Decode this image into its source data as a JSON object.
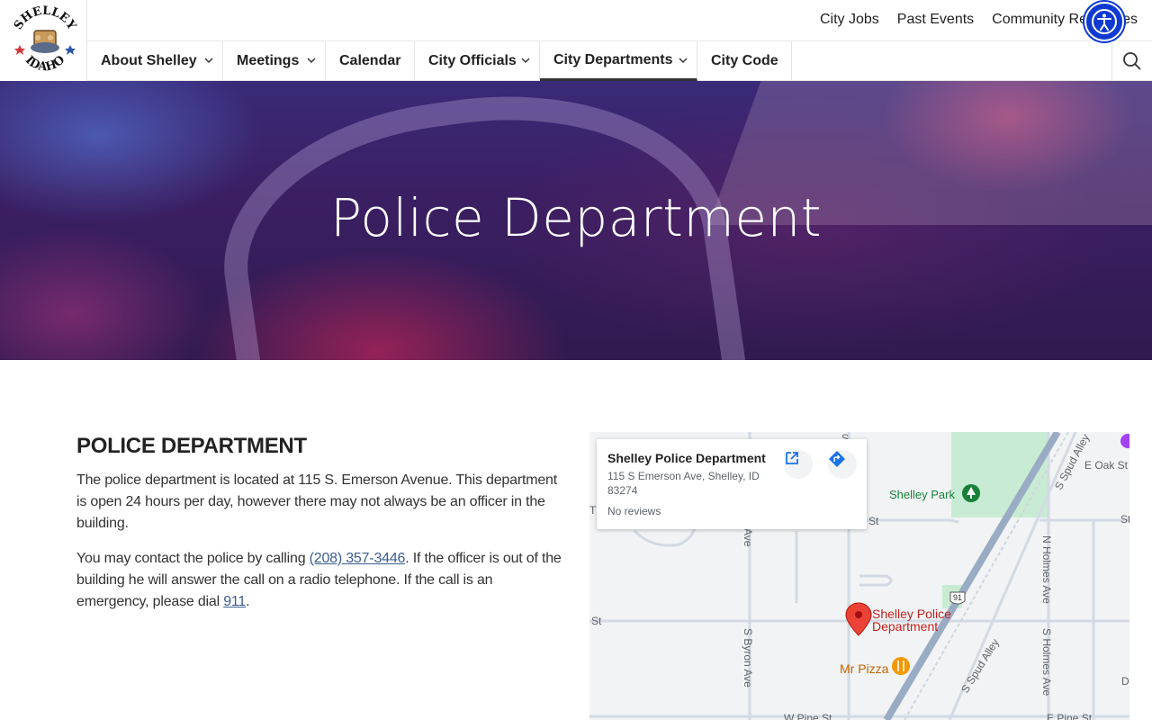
{
  "logo": {
    "top_text": "SHELLEY",
    "bottom_text": "IDAHO"
  },
  "top_links": [
    "City Jobs",
    "Past Events",
    "Community Resources"
  ],
  "nav": {
    "items": [
      {
        "label": "About Shelley"
      },
      {
        "label": "Meetings"
      },
      {
        "label": "Calendar"
      },
      {
        "label": "City Officials"
      },
      {
        "label": "City Departments"
      },
      {
        "label": "City Code"
      }
    ]
  },
  "hero": {
    "title": "Police Department"
  },
  "content": {
    "heading": "POLICE DEPARTMENT",
    "p1": "The police department is located at 115 S. Emerson Avenue. This department is open 24 hours per day, however there may not always be an officer in the building.",
    "p2_before": "You may contact the police by calling ",
    "phone": "(208) 357-3446",
    "p2_middle": ". If the officer is out of the building he will answer the call on a radio telephone. If the call is an emergency, please dial ",
    "emergency": "911",
    "p2_after": "."
  },
  "map": {
    "place_name": "Shelley Police Department",
    "address": "115 S Emerson Ave, Shelley, ID 83274",
    "reviews": "No reviews",
    "pin_label_line1": "Shelley Police",
    "pin_label_line2": "Department",
    "park": "Shelley Park",
    "restaurant": "Mr Pizza",
    "streets": {
      "e_oak": "E Oak St",
      "st_a": "St",
      "st_b": "St",
      "st_c": "St",
      "s_spud": "S Spud Alley",
      "s_spud2": "S Spud Alley",
      "n_holmes": "N Holmes Ave",
      "s_holmes": "S Holmes Ave",
      "s_byron": "S Byron Ave",
      "ave": "Ave",
      "w_pine": "W Pine St",
      "e_pine": "E Pine St",
      "hwy": "91",
      "s_letter": "S",
      "s_letter2": "S",
      "d_letter": "D",
      "th": "Th"
    }
  },
  "colors": {
    "accessibility": "#0f3ad1",
    "link": "#3a5c8f",
    "pin": "#ea4335",
    "park": "#c8ecd3"
  }
}
